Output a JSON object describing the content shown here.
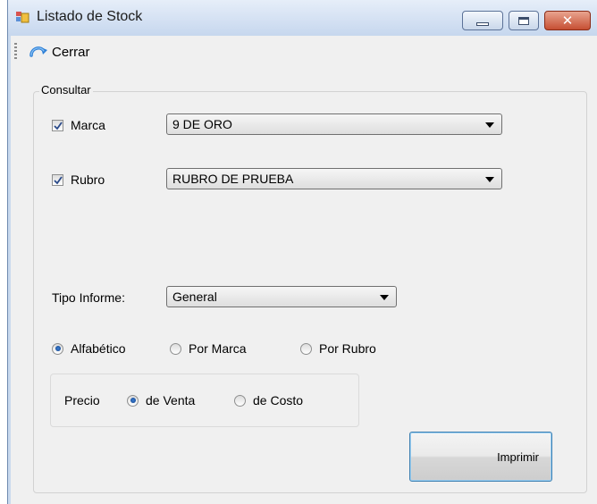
{
  "window": {
    "title": "Listado de Stock",
    "close_glyph": "✕"
  },
  "toolbar": {
    "close_label": "Cerrar",
    "close_icon": "refresh-arrow-icon"
  },
  "group": {
    "legend": "Consultar"
  },
  "filters": {
    "marca": {
      "label": "Marca",
      "checked": true,
      "value": "9 DE ORO"
    },
    "rubro": {
      "label": "Rubro",
      "checked": true,
      "value": "RUBRO DE PRUEBA"
    }
  },
  "tipo_informe": {
    "label": "Tipo Informe:",
    "value": "General"
  },
  "orden": {
    "options": [
      "Alfabético",
      "Por Marca",
      "Por Rubro"
    ],
    "selected": "Alfabético"
  },
  "precio": {
    "label": "Precio",
    "options": [
      "de Venta",
      "de Costo"
    ],
    "selected": "de Venta"
  },
  "actions": {
    "print_label": "Imprimir"
  },
  "colors": {
    "accent": "#3c7fb1",
    "radio_dot": "#0b3f8a"
  }
}
